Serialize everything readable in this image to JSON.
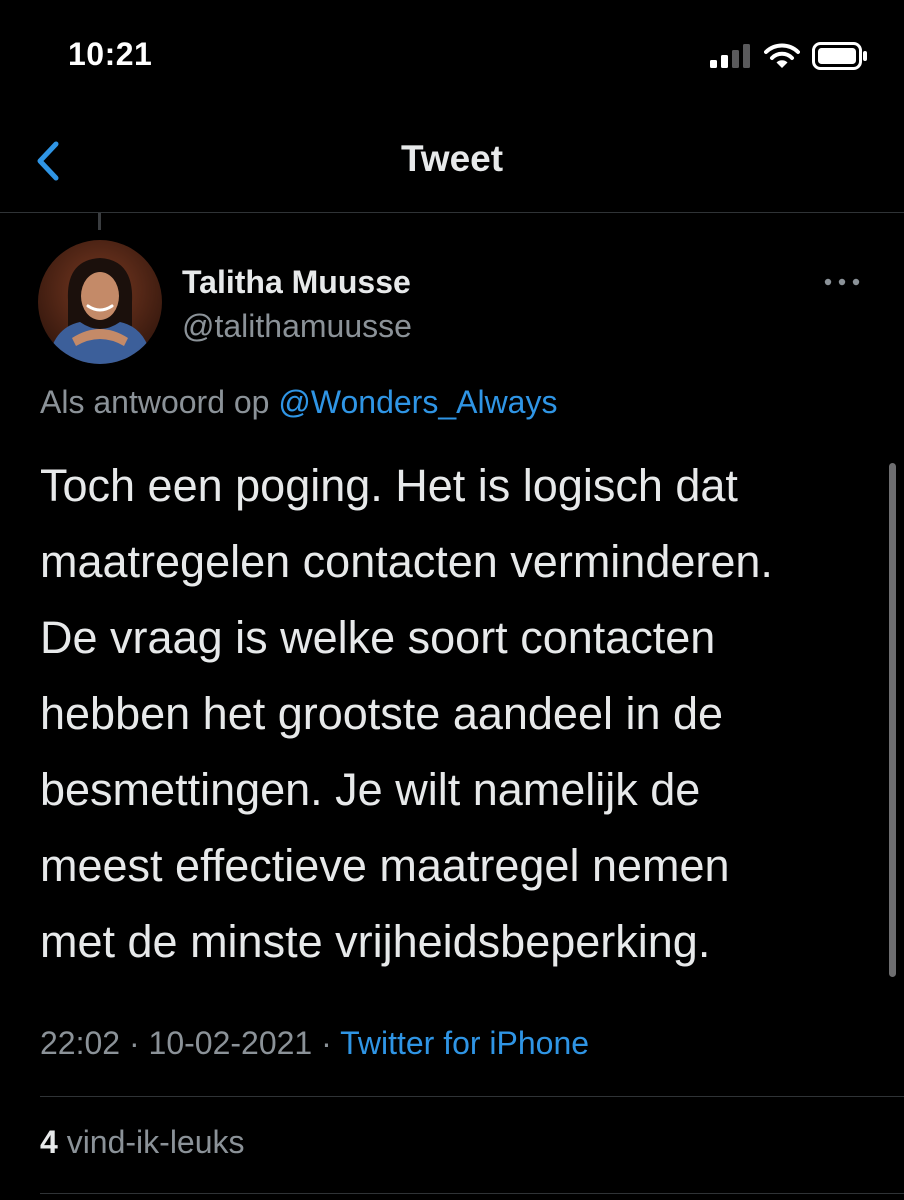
{
  "status_bar": {
    "time": "10:21",
    "icons": [
      "cellular-signal-icon",
      "wifi-icon",
      "battery-icon"
    ]
  },
  "nav": {
    "back_icon": "chevron-left-icon",
    "title": "Tweet"
  },
  "tweet": {
    "author_name": "Talitha Muusse",
    "author_handle": "@talithamuusse",
    "reply_prefix": "Als antwoord op",
    "reply_to": "@Wonders_Always",
    "text_lines": [
      "Toch een poging. Het is logisch dat",
      "maatregelen contacten verminderen.",
      "De vraag is welke soort contacten",
      "hebben het grootste aandeel in de",
      "besmettingen. Je wilt namelijk de",
      "meest effectieve maatregel nemen",
      "met de minste vrijheidsbeperking."
    ],
    "time": "22:02",
    "date": "10-02-2021",
    "separator": "·",
    "source": "Twitter for iPhone",
    "likes_count": "4",
    "likes_label": "vind-ik-leuks"
  },
  "colors": {
    "background": "#000000",
    "accent": "#2f95e5",
    "secondary_text": "#8b9298",
    "divider": "#2f3336"
  }
}
